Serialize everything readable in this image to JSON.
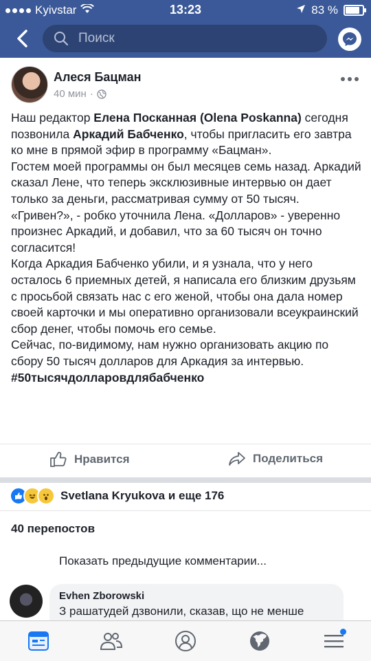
{
  "status": {
    "carrier": "Kyivstar",
    "time": "13:23",
    "battery_percent": "83 %",
    "battery_level": 0.83
  },
  "navbar": {
    "search_placeholder": "Поиск"
  },
  "post": {
    "author": "Алеся Бацман",
    "time": "40 мин",
    "paragraphs": {
      "p1_a": "Наш редактор ",
      "p1_b": "Елена Посканная (Olena Poskanna)",
      "p1_c": " сегодня позвонила ",
      "p1_d": "Аркадий Бабченко",
      "p1_e": ", чтобы пригласить его завтра ко мне в прямой эфир в программу «Бацман».",
      "p2": "Гостем моей программы он был месяцев семь назад. Аркадий сказал Лене, что теперь эксклюзивные интервью он дает только за деньги, рассматривая сумму от 50 тысяч.",
      "p3": "«Гривен?», - робко уточнила Лена. «Долларов» - уверенно произнес Аркадий, и добавил, что за 60 тысяч он точно согласится!",
      "p4": "Когда Аркадия Бабченко убили, и я узнала, что у него осталось 6 приемных детей, я написала его близким друзьям с просьбой связать нас с его женой, чтобы она дала номер своей карточки и мы оперативно организовали всеукраинский сбор денег, чтобы помочь его семье.",
      "p5": "Сейчас, по-видимому, нам нужно организовать акцию по сбору 50 тысяч долларов для Аркадия за интервью.",
      "hashtag": "#50тысячдолларовдлябабченко"
    }
  },
  "actions": {
    "like": "Нравится",
    "share": "Поделиться"
  },
  "reactions": {
    "text": "Svetlana Kryukova и еще 176"
  },
  "shares": "40 перепостов",
  "comments": {
    "show_previous": "Показать предыдущие комментарии...",
    "first": {
      "author": "Evhen Zborowski",
      "text": "З рашатудей дзвонили, сказав, що не менше"
    }
  }
}
